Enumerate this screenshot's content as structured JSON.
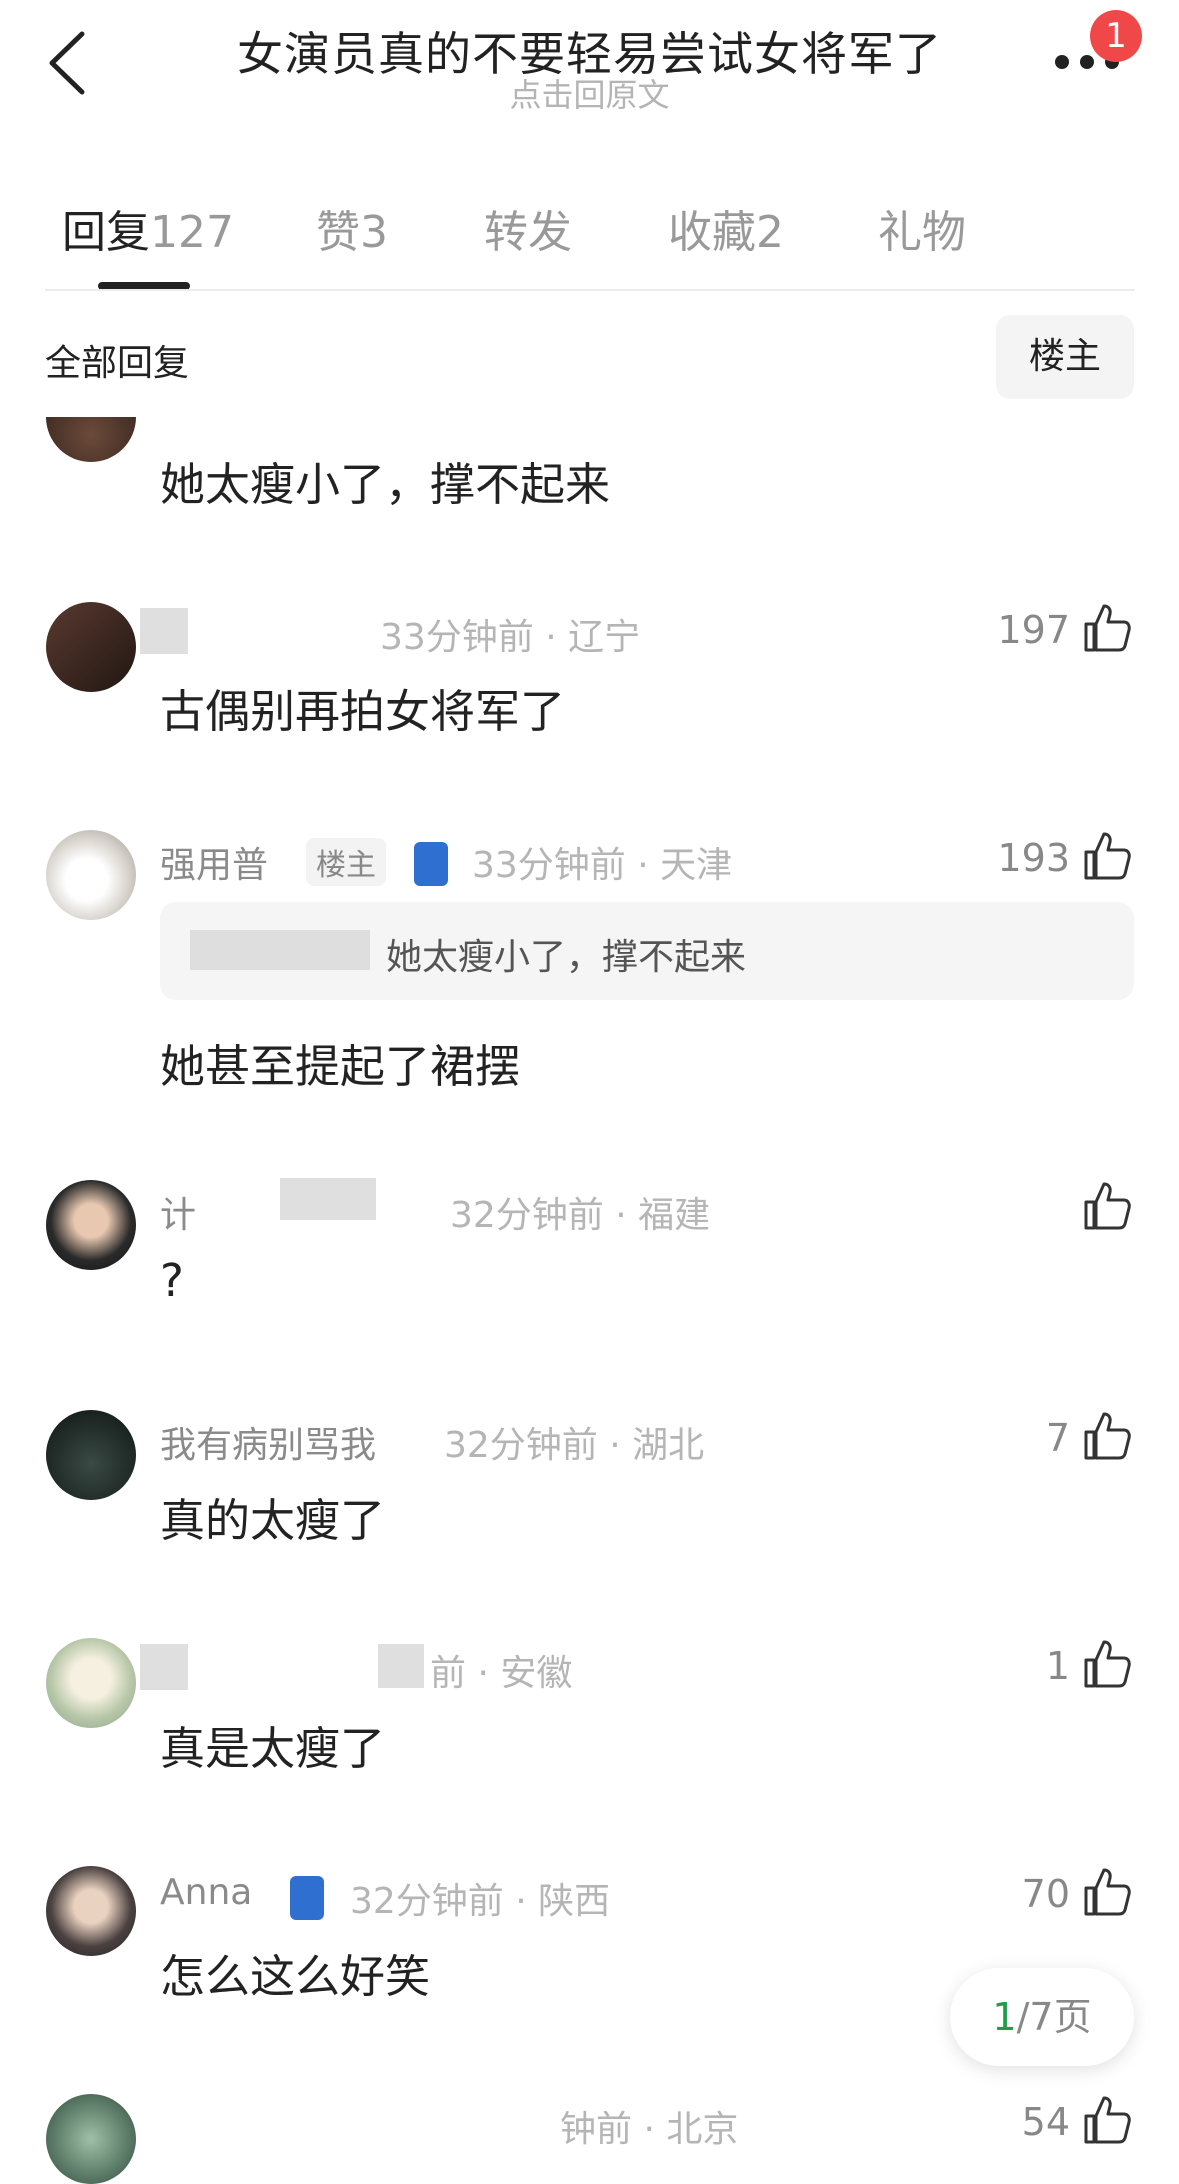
{
  "header": {
    "title": "女演员真的不要轻易尝试女将军了",
    "subtitle": "点击回原文",
    "notification_count": "1"
  },
  "tabs": [
    {
      "label": "回复",
      "count": "127"
    },
    {
      "label": "赞",
      "count": "3"
    },
    {
      "label": "转发",
      "count": ""
    },
    {
      "label": "收藏",
      "count": "2"
    },
    {
      "label": "礼物",
      "count": ""
    }
  ],
  "filter": {
    "section_label": "全部回复",
    "owner_button": "楼主"
  },
  "comments": [
    {
      "body": "她太瘦小了，撑不起来"
    },
    {
      "author": "",
      "meta": "33分钟前 · 辽宁",
      "likes": "197",
      "body": "古偶别再拍女将军了"
    },
    {
      "author": "强用普",
      "owner_tag": "楼主",
      "meta": "33分钟前 · 天津",
      "likes": "193",
      "quote": "她太瘦小了，撑不起来",
      "body": "她甚至提起了裙摆"
    },
    {
      "author": "计",
      "meta": "32分钟前 · 福建",
      "likes": "",
      "body": "?"
    },
    {
      "author": "我有病别骂我",
      "meta": "32分钟前 · 湖北",
      "likes": "7",
      "body": "真的太瘦了"
    },
    {
      "author": "",
      "meta": "前 · 安徽",
      "likes": "1",
      "body": "真是太瘦了"
    },
    {
      "author": "Anna",
      "meta": "32分钟前 · 陕西",
      "likes": "70",
      "body": "怎么这么好笑"
    },
    {
      "author": "",
      "meta": "钟前 · 北京",
      "likes": "54",
      "body": ""
    }
  ],
  "pager": {
    "current": "1",
    "total_text": "/7页"
  },
  "colors": {
    "accent_green": "#1f9d4b",
    "badge_red": "#f04848"
  }
}
